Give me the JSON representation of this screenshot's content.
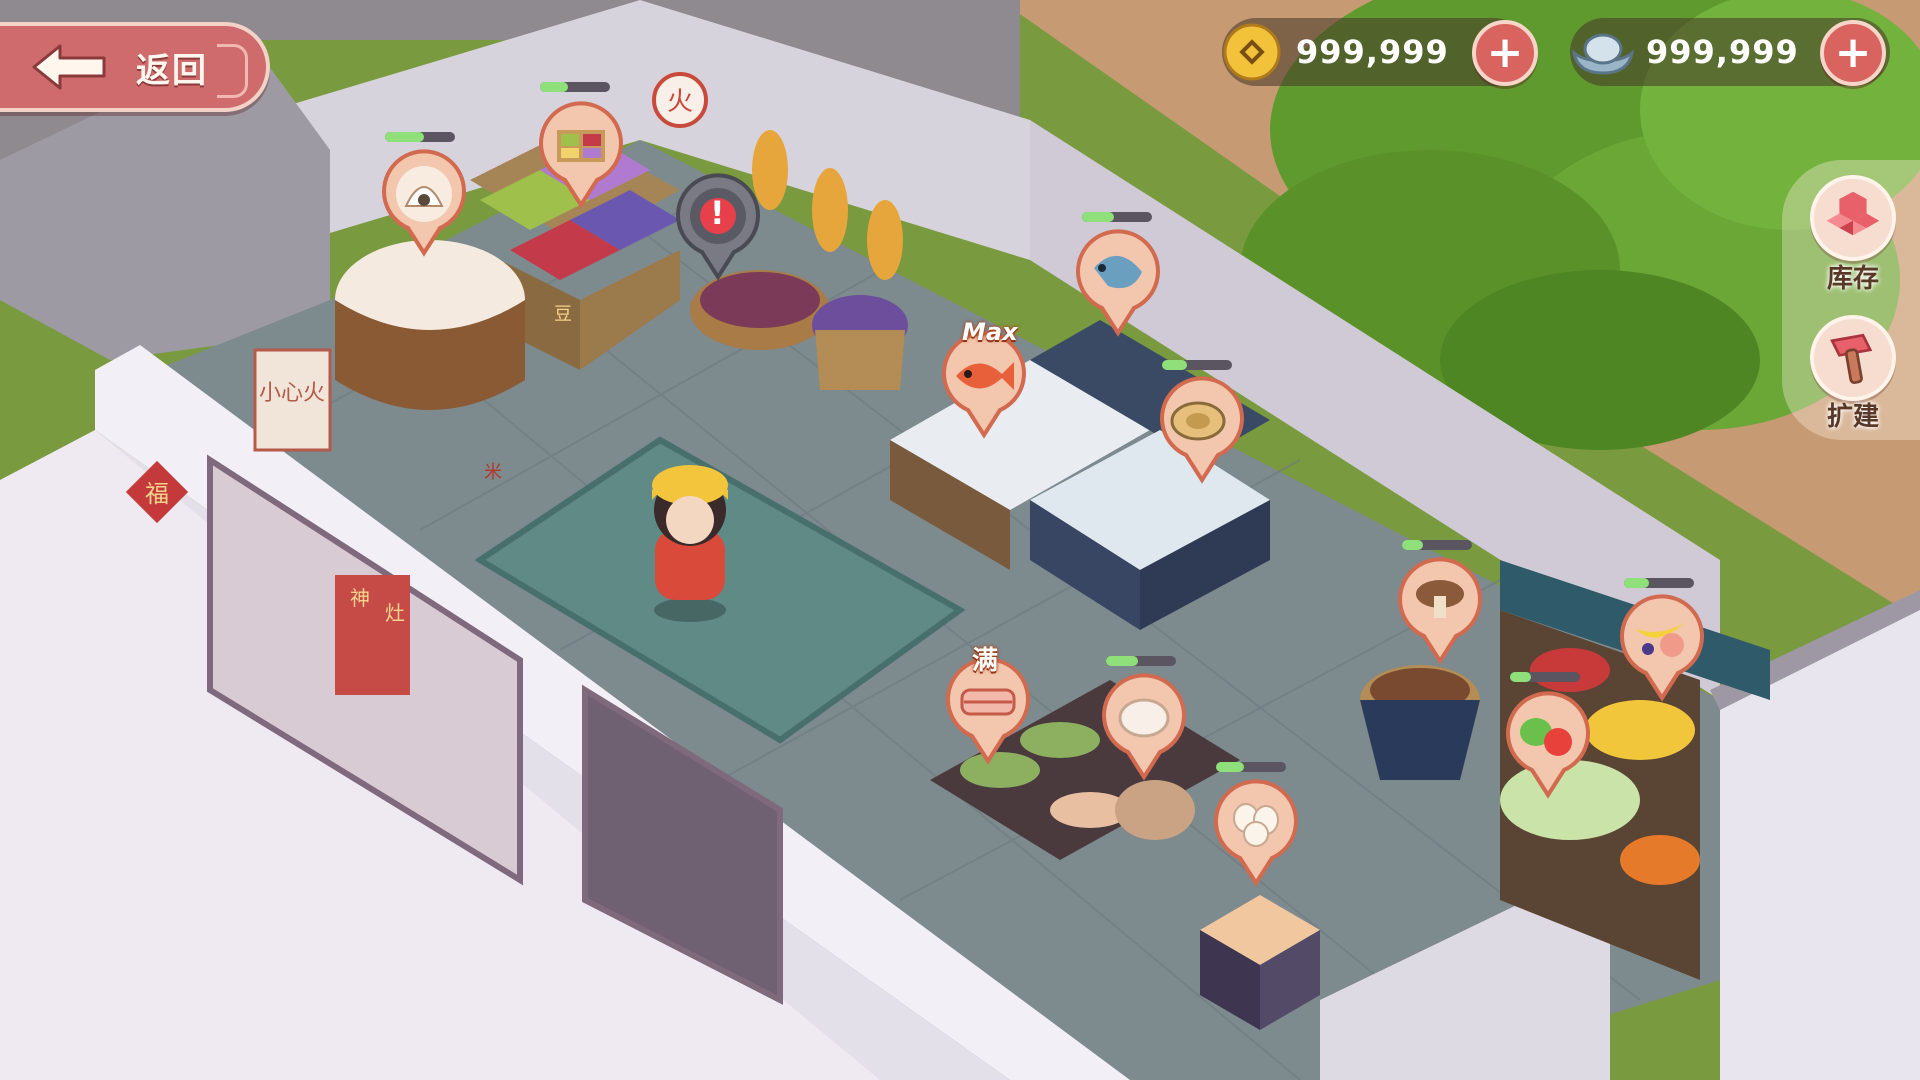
{
  "hud": {
    "back_label": "返回",
    "coins": "999,999",
    "silver": "999,999",
    "plus_symbol": "+"
  },
  "side_buttons": [
    {
      "label": "库存",
      "icon": "inventory-blocks-icon"
    },
    {
      "label": "扩建",
      "icon": "hammer-icon"
    }
  ],
  "stalls": [
    {
      "name": "rice",
      "icon": "rice-sack-icon",
      "progress": 0.55
    },
    {
      "name": "grain-box",
      "icon": "grain-box-icon",
      "progress": 0.4
    },
    {
      "name": "alert",
      "icon": "alert-icon",
      "symbol": "!"
    },
    {
      "name": "shrimp",
      "icon": "shrimp-icon",
      "progress": 0.45
    },
    {
      "name": "fish",
      "icon": "fish-icon",
      "tag": "Max"
    },
    {
      "name": "abalone",
      "icon": "abalone-icon",
      "progress": 0.35
    },
    {
      "name": "mushroom",
      "icon": "mushroom-icon",
      "progress": 0.3
    },
    {
      "name": "fruit",
      "icon": "fruit-icon",
      "progress": 0.35
    },
    {
      "name": "vegetable",
      "icon": "vegetable-icon",
      "progress": 0.3
    },
    {
      "name": "pork",
      "icon": "pork-icon",
      "tag": "满"
    },
    {
      "name": "chicken",
      "icon": "chicken-icon",
      "progress": 0.45
    },
    {
      "name": "egg",
      "icon": "egg-icon",
      "progress": 0.4
    }
  ],
  "signs": {
    "fire": "火",
    "small_heart": "小心火",
    "fortune": "福",
    "kitchen_god_1": "神",
    "kitchen_god_2": "灶",
    "beans": "豆",
    "rice_bag": "米"
  },
  "colors": {
    "accent": "#cf6b6d",
    "floor": "#7d8a8e",
    "wall": "#e9e6ef"
  }
}
